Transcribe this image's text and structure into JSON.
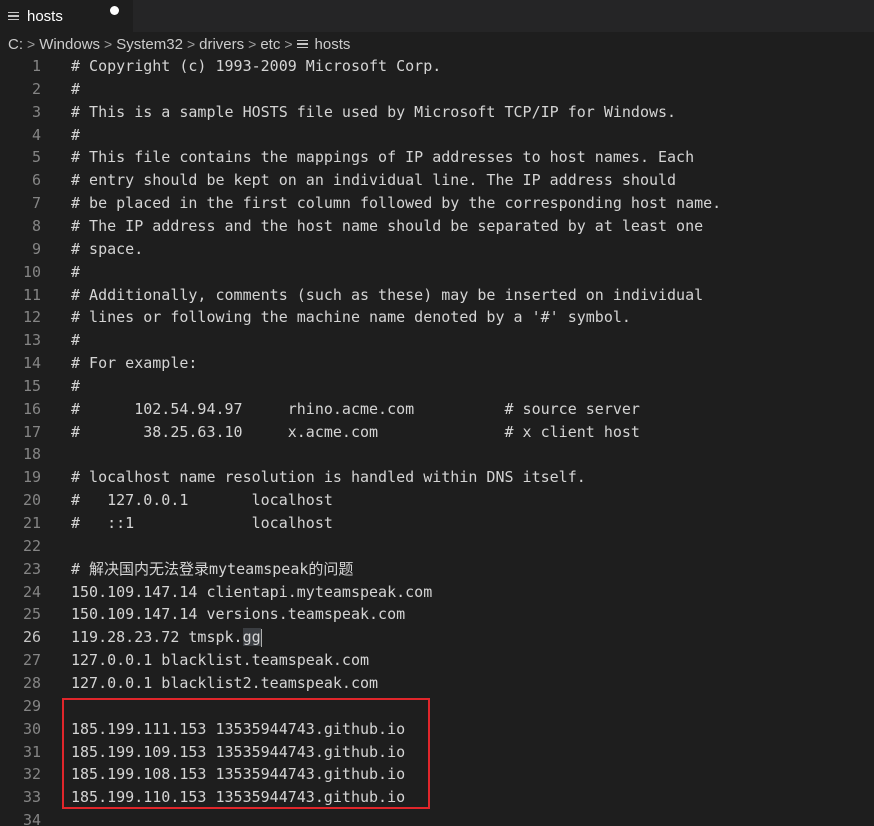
{
  "tab": {
    "title": "hosts",
    "icon": "file-lines-icon",
    "dirty": true
  },
  "breadcrumb": {
    "items": [
      "C:",
      "Windows",
      "System32",
      "drivers",
      "etc",
      "hosts"
    ],
    "separator": ">"
  },
  "editor": {
    "active_line": 26,
    "lines": [
      "# Copyright (c) 1993-2009 Microsoft Corp.",
      "#",
      "# This is a sample HOSTS file used by Microsoft TCP/IP for Windows.",
      "#",
      "# This file contains the mappings of IP addresses to host names. Each",
      "# entry should be kept on an individual line. The IP address should",
      "# be placed in the first column followed by the corresponding host name.",
      "# The IP address and the host name should be separated by at least one",
      "# space.",
      "#",
      "# Additionally, comments (such as these) may be inserted on individual",
      "# lines or following the machine name denoted by a '#' symbol.",
      "#",
      "# For example:",
      "#",
      "#      102.54.94.97     rhino.acme.com          # source server",
      "#       38.25.63.10     x.acme.com              # x client host",
      "",
      "# localhost name resolution is handled within DNS itself.",
      "#   127.0.0.1       localhost",
      "#   ::1             localhost",
      "",
      "# 解决国内无法登录myteamspeak的问题",
      "150.109.147.14 clientapi.myteamspeak.com",
      "150.109.147.14 versions.teamspeak.com",
      "119.28.23.72 tmspk.gg",
      "127.0.0.1 blacklist.teamspeak.com",
      "127.0.0.1 blacklist2.teamspeak.com",
      "",
      "185.199.111.153 13535944743.github.io",
      "185.199.109.153 13535944743.github.io",
      "185.199.108.153 13535944743.github.io",
      "185.199.110.153 13535944743.github.io",
      ""
    ],
    "active_line_prefix": "119.28.23.72 tmspk.",
    "active_line_selected": "gg"
  },
  "colors": {
    "background": "#1e1e1e",
    "tabbar": "#252526",
    "text": "#d4d4d4",
    "line_number": "#858585",
    "highlight_border": "#e0262b"
  }
}
